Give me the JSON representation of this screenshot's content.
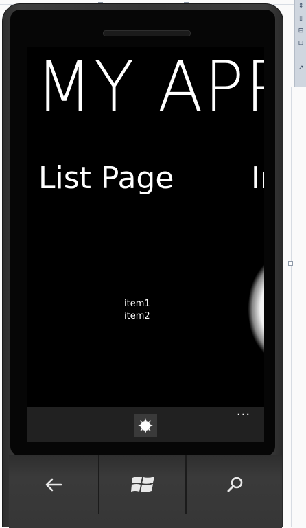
{
  "app": {
    "title": "MY APPLICATION"
  },
  "pivot": {
    "headers": [
      "List Page",
      "Image Page"
    ]
  },
  "list": {
    "items": [
      "item1",
      "item2"
    ]
  },
  "app_bar": {
    "button_icon": "sun-icon",
    "more_label": "..."
  },
  "hardware_buttons": {
    "back_icon": "back-arrow-icon",
    "start_icon": "windows-logo-icon",
    "search_icon": "search-icon"
  },
  "colors": {
    "screen_background": "#000000",
    "foreground": "#ffffff",
    "app_bar": "#212121"
  }
}
